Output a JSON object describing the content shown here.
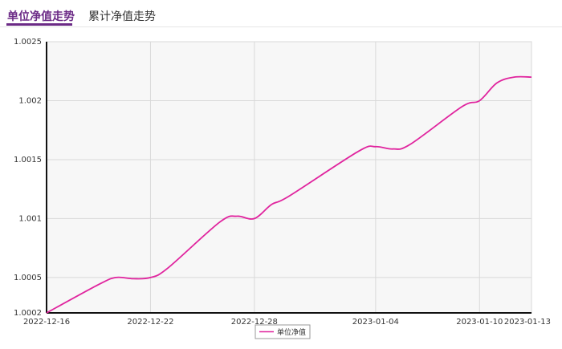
{
  "tabs": [
    {
      "label": "单位净值走势",
      "active": true
    },
    {
      "label": "累计净值走势",
      "active": false
    }
  ],
  "colors": {
    "accent": "#6b2a86",
    "line": "#e0249e",
    "grid": "#d9d9d9",
    "plot_bg": "#f7f7f7"
  },
  "chart_data": {
    "type": "line",
    "title": "",
    "xlabel": "",
    "ylabel": "",
    "x_ticks": [
      "2022-12-16",
      "2022-12-22",
      "2022-12-28",
      "2023-01-04",
      "2023-01-10",
      "2023-01-13"
    ],
    "y_ticks": [
      "1.0002",
      "1.0005",
      "1.001",
      "1.0015",
      "1.002",
      "1.0025"
    ],
    "ylim": [
      1.0002,
      1.0025
    ],
    "grid": true,
    "legend_position": "bottom-center",
    "series": [
      {
        "name": "单位净值",
        "points": [
          [
            "2022-12-16",
            1.0002
          ],
          [
            "2022-12-19",
            1.00044
          ],
          [
            "2022-12-20",
            1.0005
          ],
          [
            "2022-12-21",
            1.00049
          ],
          [
            "2022-12-22",
            1.0005
          ],
          [
            "2022-12-23",
            1.00058
          ],
          [
            "2022-12-26",
            1.00097
          ],
          [
            "2022-12-27",
            1.00102
          ],
          [
            "2022-12-28",
            1.001
          ],
          [
            "2022-12-29",
            1.00112
          ],
          [
            "2022-12-30",
            1.00119
          ],
          [
            "2023-01-03",
            1.00157
          ],
          [
            "2023-01-04",
            1.00161
          ],
          [
            "2023-01-05",
            1.00159
          ],
          [
            "2023-01-06",
            1.00163
          ],
          [
            "2023-01-09",
            1.00195
          ],
          [
            "2023-01-10",
            1.002
          ],
          [
            "2023-01-11",
            1.00215
          ],
          [
            "2023-01-12",
            1.0022
          ],
          [
            "2023-01-13",
            1.0022
          ]
        ]
      }
    ]
  }
}
